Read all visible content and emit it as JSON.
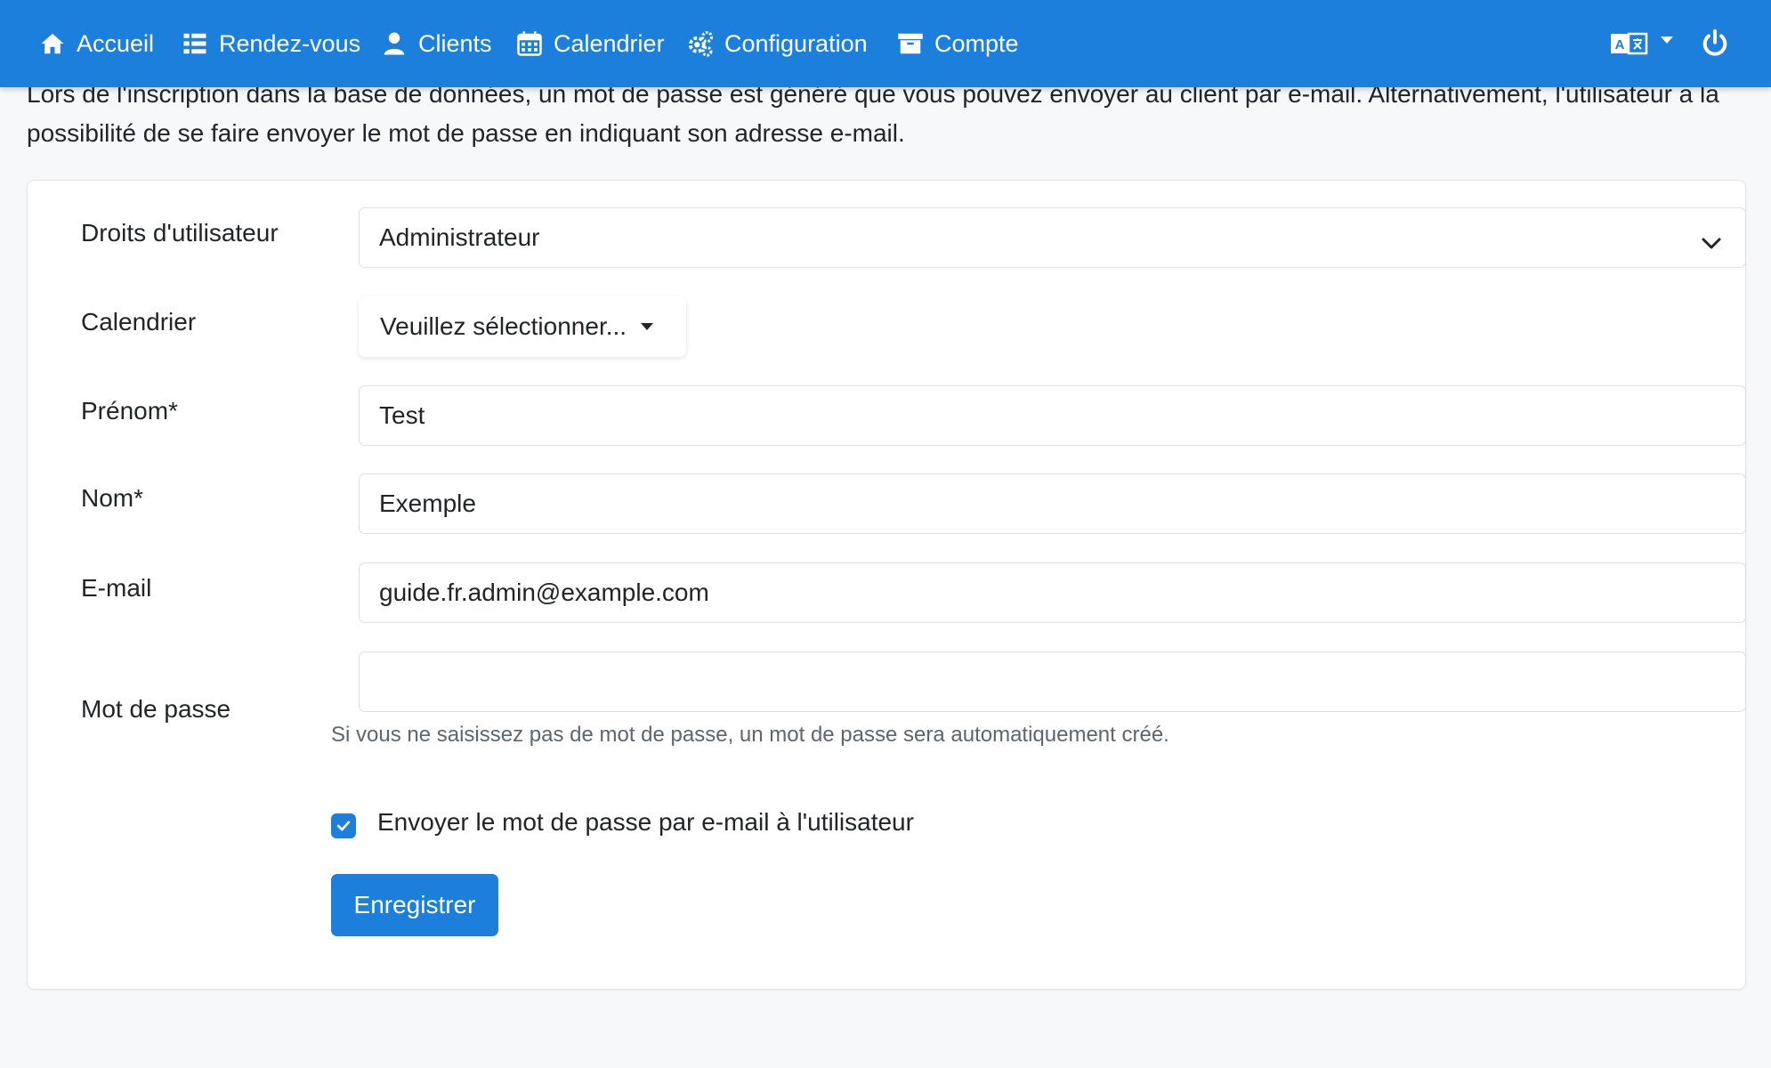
{
  "navbar": {
    "items": [
      {
        "label": "Accueil",
        "icon": "home-icon"
      },
      {
        "label": "Rendez-vous",
        "icon": "list-icon"
      },
      {
        "label": "Clients",
        "icon": "user-icon"
      },
      {
        "label": "Calendrier",
        "icon": "calendar-icon"
      },
      {
        "label": "Configuration",
        "icon": "cogs-icon"
      },
      {
        "label": "Compte",
        "icon": "archive-icon"
      }
    ],
    "language_icon": "language-icon",
    "power_icon": "power-icon",
    "background": "#1b7fdb"
  },
  "intro": {
    "text": "Lors de l'inscription dans la base de données, un mot de passe est généré que vous pouvez envoyer au client par e-mail. Alternativement, l'utilisateur a la possibilité de se faire envoyer le mot de passe en indiquant son adresse e-mail."
  },
  "form": {
    "rights": {
      "label": "Droits d'utilisateur",
      "value": "Administrateur"
    },
    "calendar": {
      "label": "Calendrier",
      "value": "Veuillez sélectionner..."
    },
    "firstname": {
      "label": "Prénom*",
      "value": "Test"
    },
    "lastname": {
      "label": "Nom*",
      "value": "Exemple"
    },
    "email": {
      "label": "E-mail",
      "value": "guide.fr.admin@example.com"
    },
    "password": {
      "label": "Mot de passe",
      "value": "",
      "help": "Si vous ne saisissez pas de mot de passe, un mot de passe sera automatiquement créé."
    },
    "send_password": {
      "label": "Envoyer le mot de passe par e-mail à l'utilisateur",
      "checked": true
    },
    "save_label": "Enregistrer"
  },
  "colors": {
    "accent": "#1b7fdb",
    "page_bg": "#f7f8fa"
  }
}
